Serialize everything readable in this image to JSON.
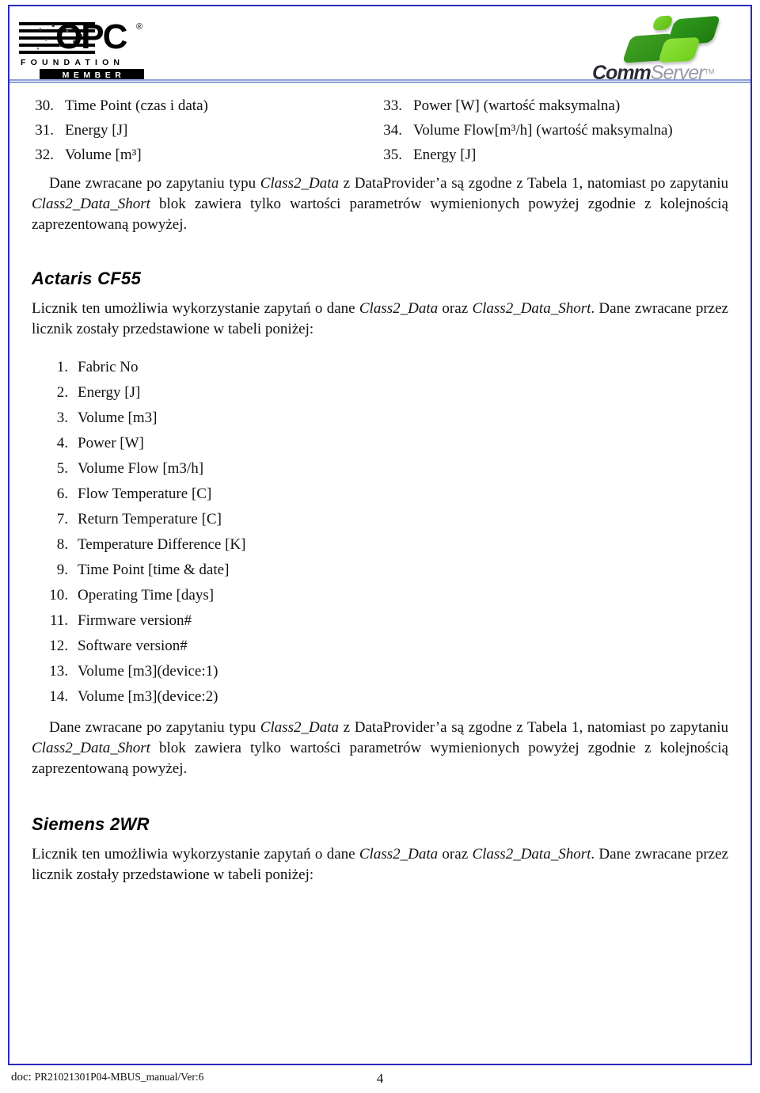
{
  "header": {
    "opc_logo": {
      "wordmark": "OPC",
      "registered": "®",
      "foundation": "FOUNDATION",
      "member": "MEMBER"
    },
    "commserver_logo": {
      "part1": "Comm",
      "part2": "Server",
      "trademark": "TM"
    }
  },
  "top_list": {
    "left": [
      {
        "n": "30.",
        "label": "Time Point (czas i data)"
      },
      {
        "n": "31.",
        "label": "Energy [J]"
      },
      {
        "n": "32.",
        "label": "Volume [m³]"
      }
    ],
    "right": [
      {
        "n": "33.",
        "label": "Power [W] (wartość maksymalna)"
      },
      {
        "n": "34.",
        "label": "Volume Flow[m³/h] (wartość maksymalna)"
      },
      {
        "n": "35.",
        "label": "Energy [J]"
      }
    ]
  },
  "paragraph_1": {
    "t1": "Dane zwracane po zapytaniu typu ",
    "i1": "Class2_Data",
    "t2": " z DataProvider’a są zgodne z Tabela 1, natomiast po zapytaniu ",
    "i2": "Class2_Data_Short",
    "t3": " blok zawiera tylko wartości parametrów wymienionych powyżej zgodnie z kolejnością zaprezentowaną powyżej."
  },
  "section_actaris": {
    "heading": "Actaris CF55",
    "intro": {
      "t1": "Licznik ten umożliwia wykorzystanie zapytań o dane ",
      "i1": "Class2_Data",
      "t2": " oraz ",
      "i2": "Class2_Data_Short",
      "t3": ". Dane zwracane przez licznik zostały przedstawione w tabeli poniżej:"
    },
    "items": [
      {
        "n": "1.",
        "label": "Fabric No"
      },
      {
        "n": "2.",
        "label": "Energy [J]"
      },
      {
        "n": "3.",
        "label": "Volume [m3]"
      },
      {
        "n": "4.",
        "label": "Power [W]"
      },
      {
        "n": "5.",
        "label": "Volume Flow [m3/h]"
      },
      {
        "n": "6.",
        "label": "Flow Temperature [C]"
      },
      {
        "n": "7.",
        "label": "Return Temperature [C]"
      },
      {
        "n": "8.",
        "label": "Temperature Difference [K]"
      },
      {
        "n": "9.",
        "label": "Time Point [time & date]"
      },
      {
        "n": "10.",
        "label": "Operating Time [days]"
      },
      {
        "n": "11.",
        "label": "Firmware version#"
      },
      {
        "n": "12.",
        "label": "Software version#"
      },
      {
        "n": "13.",
        "label": "Volume [m3](device:1)"
      },
      {
        "n": "14.",
        "label": "Volume [m3](device:2)"
      }
    ]
  },
  "paragraph_2": {
    "t1": "Dane zwracane po zapytaniu typu ",
    "i1": "Class2_Data",
    "t2": " z DataProvider’a są zgodne z Tabela 1, natomiast po zapytaniu ",
    "i2": "Class2_Data_Short",
    "t3": " blok zawiera tylko wartości parametrów wymienionych powyżej zgodnie z kolejnością zaprezentowaną powyżej."
  },
  "section_siemens": {
    "heading": "Siemens  2WR",
    "intro": {
      "t1": "Licznik ten umożliwia wykorzystanie zapytań o dane ",
      "i1": "Class2_Data",
      "t2": " oraz ",
      "i2": "Class2_Data_Short",
      "t3": ". Dane zwracane przez licznik zostały przedstawione w tabeli poniżej:"
    }
  },
  "footer": {
    "doc_prefix": "doc: ",
    "doc_code": "PR21021301P04-MBUS_manual/Ver:6",
    "page_number": "4"
  },
  "colors": {
    "frame_blue": "#2a2ac0",
    "rule_blue": "#8ea3d6",
    "logo_green": "#3fa122",
    "logo_green_light": "#8fe23c",
    "text": "#111111"
  }
}
